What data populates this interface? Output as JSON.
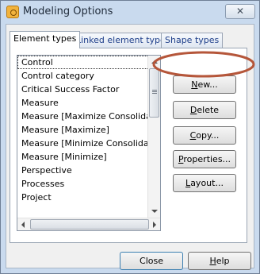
{
  "window": {
    "title": "Modeling Options",
    "close_glyph": "✕"
  },
  "tabs": [
    {
      "label": "Element types",
      "active": true
    },
    {
      "label": "Linked element types",
      "active": false
    },
    {
      "label": "Shape types",
      "active": false
    }
  ],
  "list": {
    "items": [
      "Control",
      "Control category",
      "Critical Success Factor",
      "Measure",
      "Measure [Maximize Consolidate]",
      "Measure [Maximize]",
      "Measure [Minimize Consolidate]",
      "Measure [Minimize]",
      "Perspective",
      "Processes",
      "Project"
    ],
    "selected": "Control"
  },
  "buttons": {
    "new": {
      "mnemonic": "N",
      "rest": "ew..."
    },
    "delete": {
      "mnemonic": "D",
      "rest": "elete"
    },
    "copy": {
      "mnemonic": "C",
      "rest": "opy..."
    },
    "properties": {
      "mnemonic": "P",
      "rest": "roperties..."
    },
    "layout": {
      "mnemonic": "L",
      "rest": "ayout..."
    },
    "close": "Close",
    "help": {
      "mnemonic": "H",
      "rest": "elp"
    }
  },
  "annotation": {
    "highlight_color": "#b5563a",
    "target": "new-button"
  }
}
